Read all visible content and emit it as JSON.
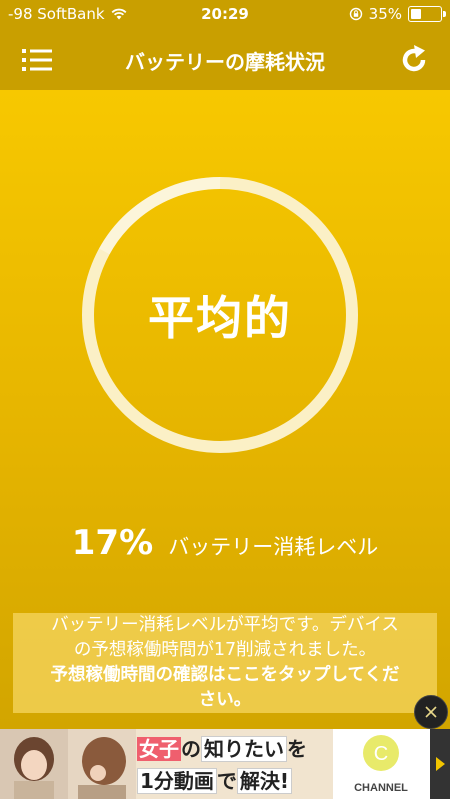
{
  "status_bar": {
    "carrier": "-98 SoftBank",
    "time": "20:29",
    "battery_pct": "35%",
    "battery_level": 0.35
  },
  "nav": {
    "title": "バッテリーの摩耗状況"
  },
  "gauge": {
    "label": "平均的",
    "value_pct": 17
  },
  "level": {
    "percent": "17%",
    "text": "バッテリー消耗レベル"
  },
  "info": {
    "line1": "バッテリー消耗レベルが平均です。デバイス",
    "line2": "の予想稼働時間が17削減されました。",
    "line3": "予想稼働時間の確認はここをタップしてくだ",
    "line4": "さい。"
  },
  "ad": {
    "w1": "女子",
    "w2": "の",
    "w3": "知りたい",
    "w4": "を",
    "w5": "1分動画",
    "w6": "で",
    "w7": "解決!",
    "logo_text": "CHANNEL",
    "logo_letter": "C"
  },
  "colors": {
    "header": "#c99f00",
    "background": "#f7c800",
    "ring": "#fbf0c6"
  }
}
